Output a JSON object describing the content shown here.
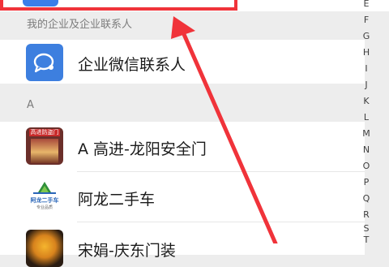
{
  "sections": [
    {
      "header": "我的企业及企业联系人"
    },
    {
      "header": "A"
    }
  ],
  "rows": [
    {
      "label": "企业微信联系人"
    },
    {
      "label": "A 高进-龙阳安全门",
      "avatar_text": "高进防盗门"
    },
    {
      "label": "阿龙二手车",
      "avatar_title": "阿龙二手车",
      "avatar_subtitle": "专业品质"
    },
    {
      "label": "宋娟-庆东门装"
    }
  ],
  "index_letters": [
    "E",
    "F",
    "G",
    "H",
    "I",
    "J",
    "K",
    "L",
    "M",
    "N",
    "O",
    "P",
    "Q",
    "R",
    "S",
    "T"
  ],
  "colors": {
    "highlight": "#f0333a",
    "wecom_blue": "#3d7fdf",
    "background": "#ededed"
  }
}
